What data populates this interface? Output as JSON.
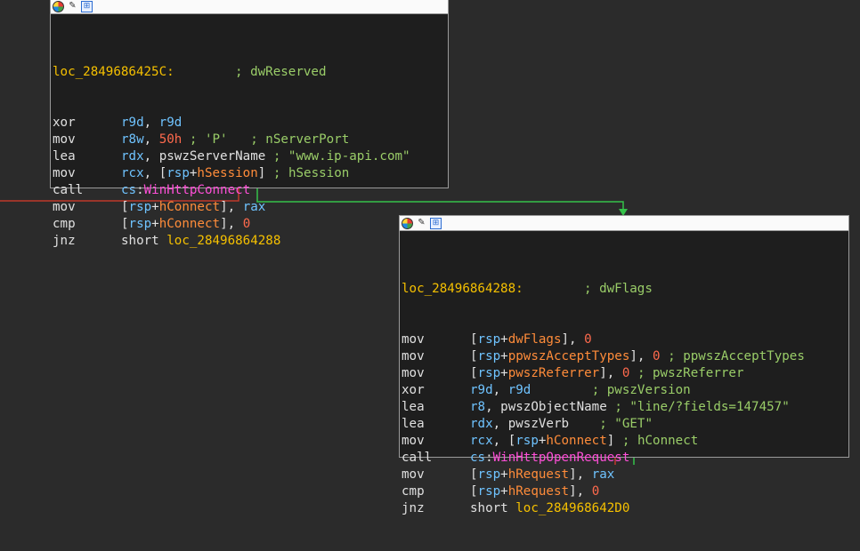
{
  "node1": {
    "label": "loc_2849686425C:",
    "label_comment": "; dwReserved",
    "lines": [
      {
        "mnem": "xor",
        "parts": [
          [
            "reg",
            "r9d"
          ],
          [
            "op",
            ", "
          ],
          [
            "reg",
            "r9d"
          ]
        ]
      },
      {
        "mnem": "mov",
        "parts": [
          [
            "reg",
            "r8w"
          ],
          [
            "op",
            ", "
          ],
          [
            "num",
            "50h"
          ],
          [
            "op",
            " "
          ],
          [
            "cmt",
            "; 'P'   ; nServerPort"
          ]
        ]
      },
      {
        "mnem": "lea",
        "parts": [
          [
            "reg",
            "rdx"
          ],
          [
            "op",
            ", pswzServerName "
          ],
          [
            "cmt",
            "; \"www.ip-api.com\""
          ]
        ]
      },
      {
        "mnem": "mov",
        "parts": [
          [
            "reg",
            "rcx"
          ],
          [
            "op",
            ", ["
          ],
          [
            "reg",
            "rsp"
          ],
          [
            "op",
            "+"
          ],
          [
            "var",
            "hSession"
          ],
          [
            "op",
            "] "
          ],
          [
            "cmt",
            "; hSession"
          ]
        ]
      },
      {
        "mnem": "call",
        "parts": [
          [
            "reg",
            "cs"
          ],
          [
            "op",
            ":"
          ],
          [
            "imp",
            "WinHttpConnect"
          ]
        ]
      },
      {
        "mnem": "mov",
        "parts": [
          [
            "op",
            "["
          ],
          [
            "reg",
            "rsp"
          ],
          [
            "op",
            "+"
          ],
          [
            "var",
            "hConnect"
          ],
          [
            "op",
            "], "
          ],
          [
            "reg",
            "rax"
          ]
        ]
      },
      {
        "mnem": "cmp",
        "parts": [
          [
            "op",
            "["
          ],
          [
            "reg",
            "rsp"
          ],
          [
            "op",
            "+"
          ],
          [
            "var",
            "hConnect"
          ],
          [
            "op",
            "], "
          ],
          [
            "num",
            "0"
          ]
        ]
      },
      {
        "mnem": "jnz",
        "parts": [
          [
            "op",
            "short "
          ],
          [
            "label",
            "loc_28496864288"
          ]
        ]
      }
    ]
  },
  "node2": {
    "label": "loc_28496864288:",
    "label_comment": "; dwFlags",
    "lines": [
      {
        "mnem": "mov",
        "parts": [
          [
            "op",
            "["
          ],
          [
            "reg",
            "rsp"
          ],
          [
            "op",
            "+"
          ],
          [
            "var",
            "dwFlags"
          ],
          [
            "op",
            "], "
          ],
          [
            "num",
            "0"
          ]
        ]
      },
      {
        "mnem": "mov",
        "parts": [
          [
            "op",
            "["
          ],
          [
            "reg",
            "rsp"
          ],
          [
            "op",
            "+"
          ],
          [
            "var",
            "ppwszAcceptTypes"
          ],
          [
            "op",
            "], "
          ],
          [
            "num",
            "0"
          ],
          [
            "op",
            " "
          ],
          [
            "cmt",
            "; ppwszAcceptTypes"
          ]
        ]
      },
      {
        "mnem": "mov",
        "parts": [
          [
            "op",
            "["
          ],
          [
            "reg",
            "rsp"
          ],
          [
            "op",
            "+"
          ],
          [
            "var",
            "pwszReferrer"
          ],
          [
            "op",
            "], "
          ],
          [
            "num",
            "0"
          ],
          [
            "op",
            " "
          ],
          [
            "cmt",
            "; pwszReferrer"
          ]
        ]
      },
      {
        "mnem": "xor",
        "parts": [
          [
            "reg",
            "r9d"
          ],
          [
            "op",
            ", "
          ],
          [
            "reg",
            "r9d"
          ],
          [
            "op",
            "        "
          ],
          [
            "cmt",
            "; pwszVersion"
          ]
        ]
      },
      {
        "mnem": "lea",
        "parts": [
          [
            "reg",
            "r8"
          ],
          [
            "op",
            ", pwszObjectName "
          ],
          [
            "cmt",
            "; \"line/?fields=147457\""
          ]
        ]
      },
      {
        "mnem": "lea",
        "parts": [
          [
            "reg",
            "rdx"
          ],
          [
            "op",
            ", pwszVerb    "
          ],
          [
            "cmt",
            "; \"GET\""
          ]
        ]
      },
      {
        "mnem": "mov",
        "parts": [
          [
            "reg",
            "rcx"
          ],
          [
            "op",
            ", ["
          ],
          [
            "reg",
            "rsp"
          ],
          [
            "op",
            "+"
          ],
          [
            "var",
            "hConnect"
          ],
          [
            "op",
            "] "
          ],
          [
            "cmt",
            "; hConnect"
          ]
        ]
      },
      {
        "mnem": "call",
        "parts": [
          [
            "reg",
            "cs"
          ],
          [
            "op",
            ":"
          ],
          [
            "imp",
            "WinHttpOpenRequest"
          ]
        ]
      },
      {
        "mnem": "mov",
        "parts": [
          [
            "op",
            "["
          ],
          [
            "reg",
            "rsp"
          ],
          [
            "op",
            "+"
          ],
          [
            "var",
            "hRequest"
          ],
          [
            "op",
            "], "
          ],
          [
            "reg",
            "rax"
          ]
        ]
      },
      {
        "mnem": "cmp",
        "parts": [
          [
            "op",
            "["
          ],
          [
            "reg",
            "rsp"
          ],
          [
            "op",
            "+"
          ],
          [
            "var",
            "hRequest"
          ],
          [
            "op",
            "], "
          ],
          [
            "num",
            "0"
          ]
        ]
      },
      {
        "mnem": "jnz",
        "parts": [
          [
            "op",
            "short "
          ],
          [
            "label",
            "loc_284968642D0"
          ]
        ]
      }
    ]
  },
  "header_icons": [
    "node-color-icon",
    "rename-icon",
    "graph-overview-icon"
  ],
  "colors": {
    "true_edge": "#35c24a",
    "false_edge": "#c0392b",
    "edge_default": "#2f6fd6"
  }
}
